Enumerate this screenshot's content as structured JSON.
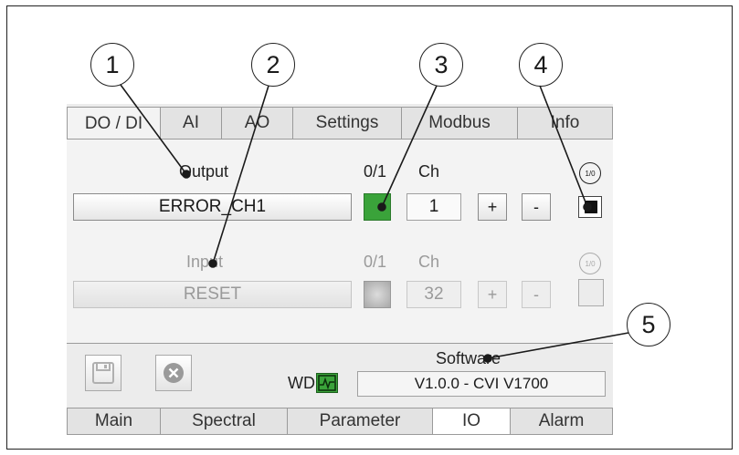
{
  "callouts": [
    "1",
    "2",
    "3",
    "4",
    "5"
  ],
  "top_tabs": [
    "DO / DI",
    "AI",
    "AO",
    "Settings",
    "Modbus",
    "Info"
  ],
  "output": {
    "label": "Output",
    "col_01": "0/1",
    "col_ch": "Ch",
    "button": "ERROR_CH1",
    "channel": "1",
    "plus": "+",
    "minus": "-",
    "cycle_text": "1/0",
    "indicator_color": "#3aa33a"
  },
  "input": {
    "label": "Input",
    "col_01": "0/1",
    "col_ch": "Ch",
    "button": "RESET",
    "channel": "32",
    "plus": "+",
    "minus": "-",
    "cycle_text": "1/0"
  },
  "footer": {
    "software_label": "Software",
    "wd_label": "WD",
    "version": "V1.0.0  - CVI V1700"
  },
  "bottom_tabs": [
    "Main",
    "Spectral",
    "Parameter",
    "IO",
    "Alarm"
  ],
  "active_top_tab": "DO / DI",
  "active_bottom_tab": "IO"
}
